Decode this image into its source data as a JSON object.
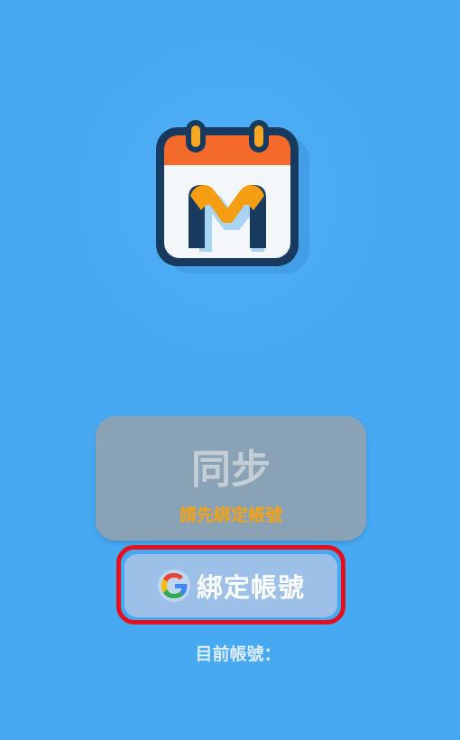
{
  "app": {
    "logo_icon": "calendar-m-icon",
    "logo_letter": "M",
    "background_color": "#47a9f2"
  },
  "sync": {
    "label": "同步",
    "hint": "請先綁定帳號",
    "disabled": true
  },
  "bind": {
    "icon": "google-icon",
    "label": "綁定帳號"
  },
  "account": {
    "label": "目前帳號："
  },
  "colors": {
    "highlight": "#e3101d",
    "hint": "#f0a21a",
    "sync_bg": "#8aa2b5",
    "bind_bg": "#9cc0e8"
  }
}
